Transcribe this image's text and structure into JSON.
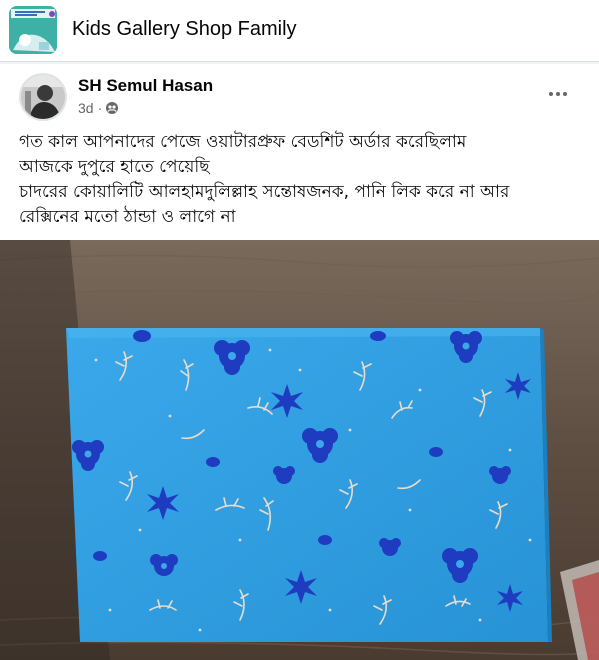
{
  "group": {
    "name": "Kids Gallery Shop Family",
    "thumb_icon": "group-cover-thumbnail"
  },
  "post": {
    "author": "SH Semul Hasan",
    "time": "3d",
    "separator": "·",
    "audience_icon": "friends-group-icon",
    "more_icon": "more-options-icon",
    "text_lines": [
      "গত কাল আপনাদের পেজে ওয়াটারপ্রুফ বেডশিট অর্ডার করেছিলাম",
      "আজকে দুপুরে হাতে পেয়েছি",
      "চাদরের কোয়ালিটি আলহামদুলিল্লাহ সন্তোষজনক, পানি লিক করে না আর",
      "রেক্সিনের মতো ঠান্ডা ও লাগে না"
    ],
    "photo_subject": "folded blue waterproof bedsheet with floral print",
    "colors": {
      "sheet": "#2f9fe0",
      "flowers": "#1f3bbf",
      "leaves": "#e9dcc8",
      "table": "#5a4a3e"
    }
  }
}
